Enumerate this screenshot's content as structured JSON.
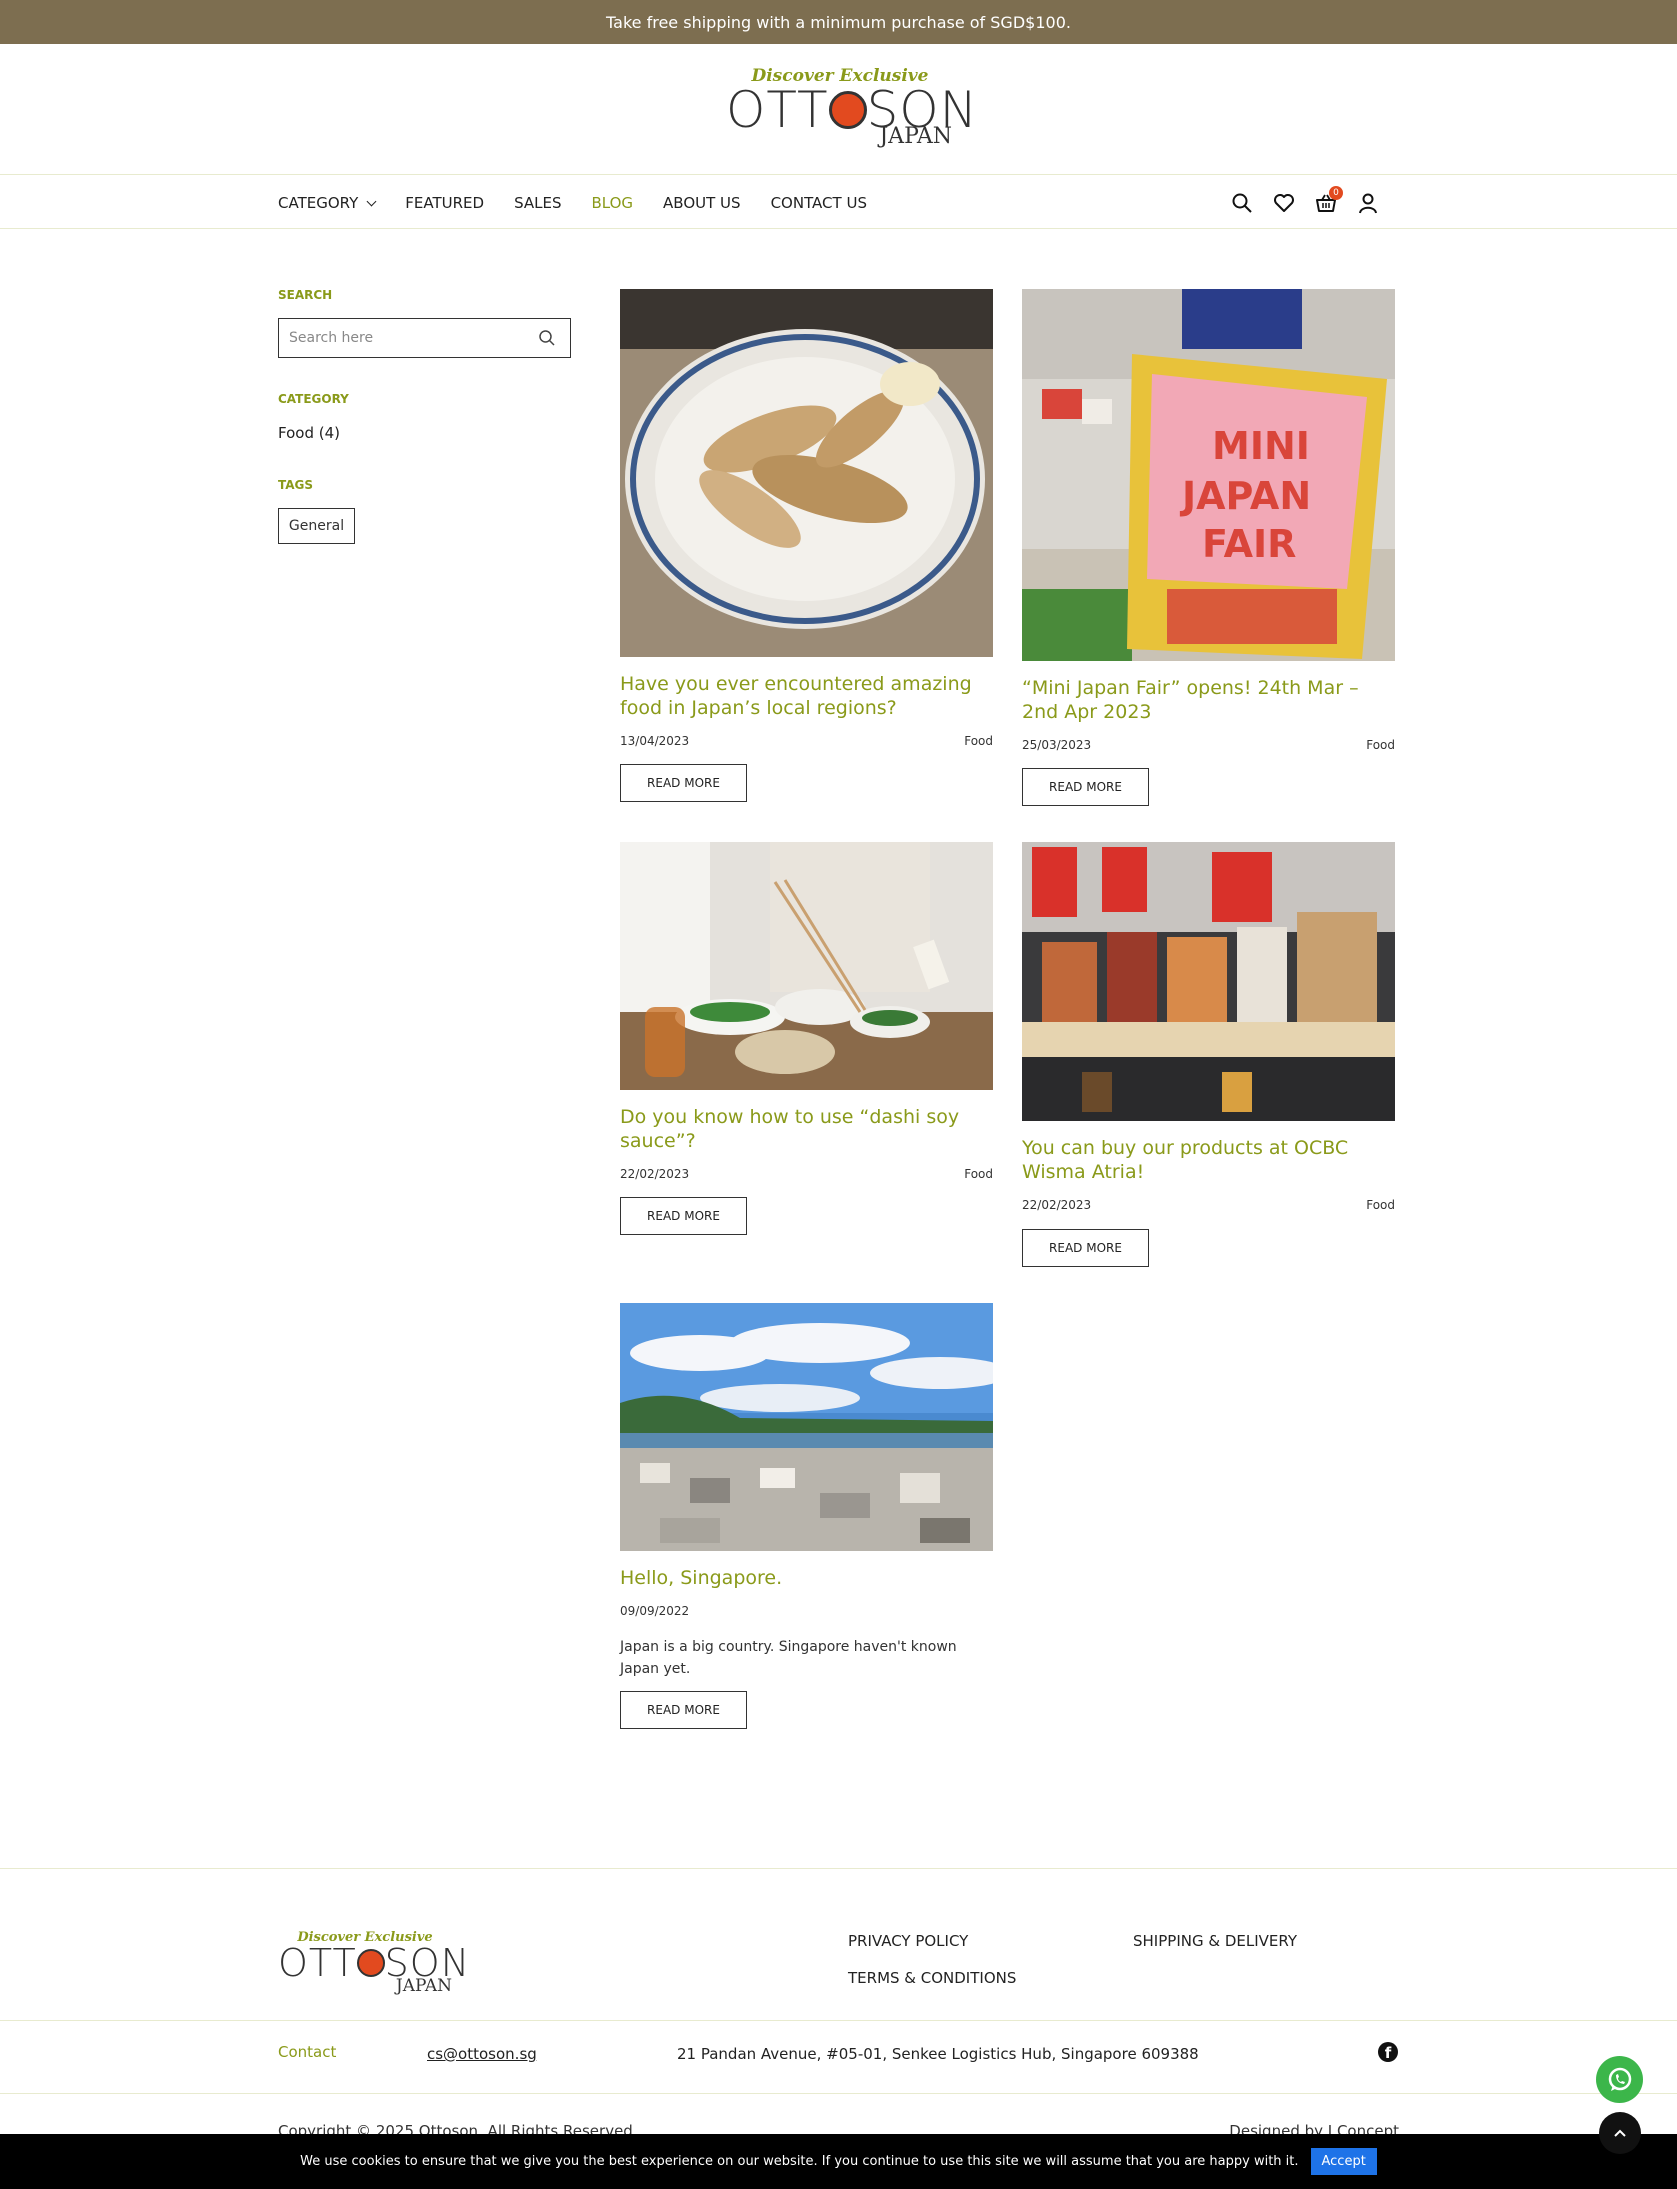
{
  "announcement": "Take free shipping with a minimum purchase of SGD$100.",
  "brand": {
    "tagline": "Discover Exclusive",
    "word_left": "OTT",
    "word_right": "SON",
    "sub": "JAPAN"
  },
  "nav": {
    "items": [
      {
        "label": "CATEGORY"
      },
      {
        "label": "FEATURED"
      },
      {
        "label": "SALES"
      },
      {
        "label": "BLOG"
      },
      {
        "label": "ABOUT US"
      },
      {
        "label": "CONTACT US"
      }
    ],
    "cart_count": "0",
    "active_color": "#8a9a1a"
  },
  "sidebar": {
    "search_heading": "SEARCH",
    "search_placeholder": "Search here",
    "category_heading": "CATEGORY",
    "category_item": "Food (4)",
    "tags_heading": "TAGS",
    "tag": "General"
  },
  "posts": [
    {
      "title": "Have you ever encountered amazing food in Japan’s local regions?",
      "date": "13/04/2023",
      "category": "Food",
      "button": "READ MORE"
    },
    {
      "title": "“Mini Japan Fair” opens! 24th Mar – 2nd Apr 2023",
      "date": "25/03/2023",
      "category": "Food",
      "button": "READ MORE",
      "sign": {
        "line1": "MINI",
        "line2": "JAPAN",
        "line3": "FAIR"
      }
    },
    {
      "title": "Do you know how to use “dashi soy sauce”?",
      "date": "22/02/2023",
      "category": "Food",
      "button": "READ MORE"
    },
    {
      "title": "You can buy our products at OCBC Wisma Atria!",
      "date": "22/02/2023",
      "category": "Food",
      "button": "READ MORE"
    },
    {
      "title": "Hello, Singapore.",
      "date": "09/09/2022",
      "excerpt": "Japan is a big country. Singapore haven't known Japan yet.",
      "button": "READ MORE"
    }
  ],
  "footer": {
    "links": [
      "PRIVACY POLICY",
      "SHIPPING & DELIVERY",
      "TERMS & CONDITIONS"
    ],
    "contact_label": "Contact",
    "email": "cs@ottoson.sg",
    "address": "21 Pandan Avenue, #05-01, Senkee Logistics Hub, Singapore 609388",
    "copyright": "Copyright © 2025 Ottoson. All Rights Reserved.",
    "designed_by": "Designed by I Concept"
  },
  "cookie": {
    "message": "We use cookies to ensure that we give you the best experience on our website. If you continue to use this site we will assume that you are happy with it.",
    "accept": "Accept"
  },
  "colors": {
    "accent": "#8a9a1a",
    "announcement_bg": "#7d6e50",
    "logo_dot": "#e24a1f",
    "whatsapp": "#3cb64a",
    "accept": "#1e73e8"
  }
}
